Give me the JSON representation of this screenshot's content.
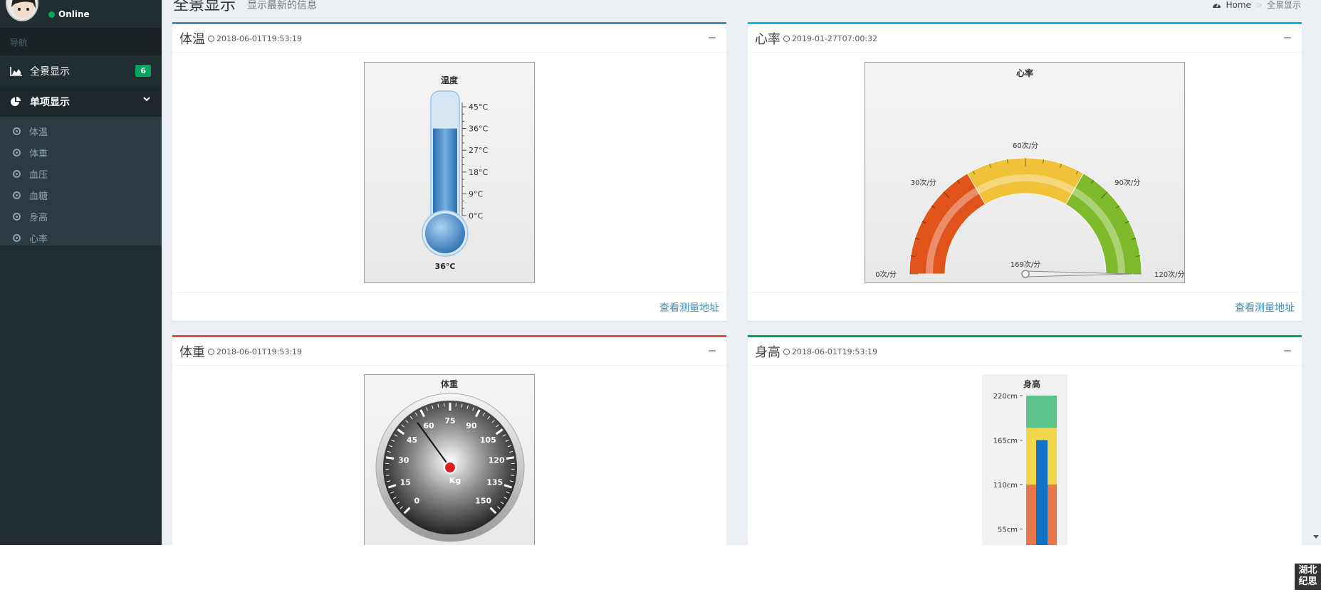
{
  "user": {
    "status": "Online"
  },
  "sidebar": {
    "nav_header": "导航",
    "overview": {
      "label": "全景显示",
      "badge": "6"
    },
    "single": {
      "label": "单项显示"
    },
    "sub_items": [
      "体温",
      "体重",
      "血压",
      "血糖",
      "身高",
      "心率"
    ]
  },
  "header": {
    "title": "全景显示",
    "subtitle": "显示最新的信息"
  },
  "breadcrumb": {
    "home": "Home",
    "current": "全景显示"
  },
  "boxes": {
    "temp": {
      "title": "体温",
      "time": "2018-06-01T19:53:19",
      "link": "查看测量地址",
      "color": "#3c8dbc"
    },
    "heart": {
      "title": "心率",
      "time": "2019-01-27T07:00:32",
      "link": "查看测量地址",
      "color": "#00c0ef"
    },
    "weight": {
      "title": "体重",
      "time": "2018-06-01T19:53:19",
      "color": "#dd4b39"
    },
    "height": {
      "title": "身高",
      "time": "2018-06-01T19:53:19",
      "color": "#00a65a"
    }
  },
  "chart_data": [
    {
      "type": "thermometer",
      "title": "温度",
      "unit": "°C",
      "ticks": [
        "45°C",
        "36°C",
        "27°C",
        "18°C",
        "9°C",
        "0°C"
      ],
      "tick_values": [
        45,
        36,
        27,
        18,
        9,
        0
      ],
      "range": [
        0,
        45
      ],
      "value": 36,
      "value_label": "36°C"
    },
    {
      "type": "gauge",
      "title": "心率",
      "range": [
        0,
        120
      ],
      "tick_labels": [
        "0次/分",
        "30次/分",
        "60次/分",
        "90次/分",
        "120次/分"
      ],
      "tick_values": [
        0,
        30,
        60,
        90,
        120
      ],
      "bands": [
        {
          "from": 0,
          "to": 40,
          "color": "#e0541c"
        },
        {
          "from": 40,
          "to": 80,
          "color": "#f0c23a"
        },
        {
          "from": 80,
          "to": 120,
          "color": "#7fba2c"
        }
      ],
      "value": 169,
      "value_label": "169次/分"
    },
    {
      "type": "dial",
      "title": "体重",
      "unit_label": "Kg",
      "range": [
        0,
        150
      ],
      "tick_labels": [
        "0",
        "15",
        "30",
        "45",
        "60",
        "75",
        "90",
        "105",
        "120",
        "135",
        "150"
      ],
      "tick_values": [
        0,
        15,
        30,
        45,
        60,
        75,
        90,
        105,
        120,
        135,
        150
      ],
      "value": 55,
      "value_label": "55"
    },
    {
      "type": "bullet",
      "title": "身高",
      "tick_labels": [
        "220cm",
        "165cm",
        "110cm",
        "55cm"
      ],
      "tick_values": [
        220,
        165,
        110,
        55
      ],
      "range": [
        0,
        220
      ],
      "bands": [
        {
          "from": 0,
          "to": 110,
          "color": "#e8784a"
        },
        {
          "from": 110,
          "to": 180,
          "color": "#f2d64b"
        },
        {
          "from": 180,
          "to": 220,
          "color": "#5cc48a"
        }
      ],
      "bar_color": "#0f72c4",
      "value": 165
    }
  ]
}
